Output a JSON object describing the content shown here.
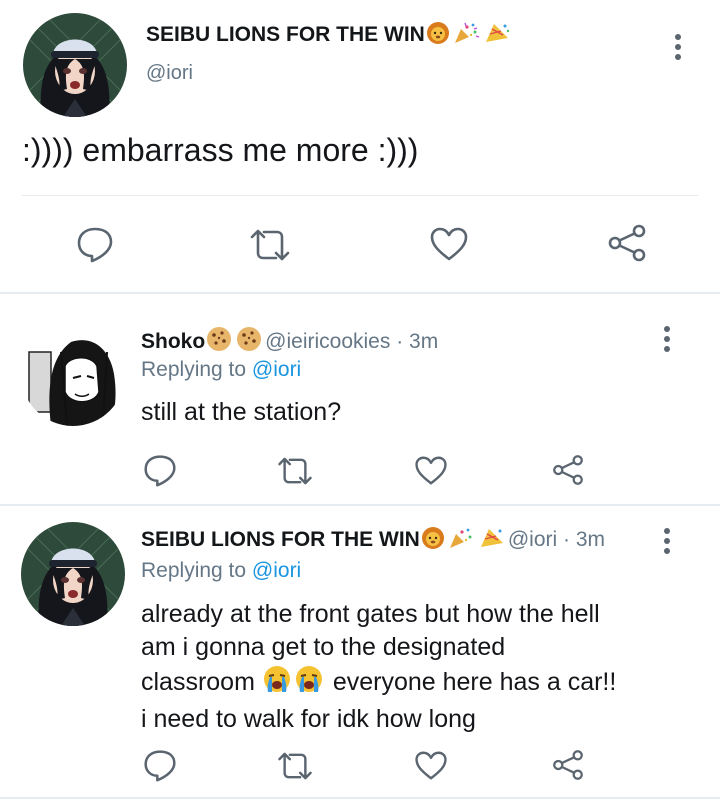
{
  "main_tweet": {
    "display_name": "SEIBU LIONS FOR THE WIN",
    "name_emojis": [
      "lion-face-emoji",
      "party-popper-emoji",
      "party-popper-emoji"
    ],
    "handle": "@iori",
    "text": ":)))) embarrass me more :)))"
  },
  "replies": [
    {
      "display_name": "Shoko",
      "name_emojis": [
        "cookie-emoji",
        "cookie-emoji"
      ],
      "handle": "@ieiricookies",
      "time": "· 3m",
      "replying_label": "Replying to",
      "replying_handle": "@iori",
      "text_lines": [
        "still at the station?"
      ]
    },
    {
      "display_name": "SEIBU LIONS FOR THE WIN",
      "name_emojis": [
        "lion-face-emoji",
        "party-popper-emoji",
        "party-popper-emoji"
      ],
      "handle": "@iori",
      "time": "· 3m",
      "replying_label": "Replying to",
      "replying_handle": "@iori",
      "text_lines": [
        "already at the front gates but how the hell",
        "am i gonna get to the designated",
        "classroom",
        "everyone here has a car!!",
        "i need to walk for idk how long"
      ],
      "inline_emojis": [
        "loudly-crying-face-emoji",
        "loudly-crying-face-emoji"
      ]
    }
  ],
  "colors": {
    "text": "#14171a",
    "muted": "#657786",
    "link": "#1b95e0",
    "icon": "#5a6570",
    "divider": "#e6ecf0"
  }
}
